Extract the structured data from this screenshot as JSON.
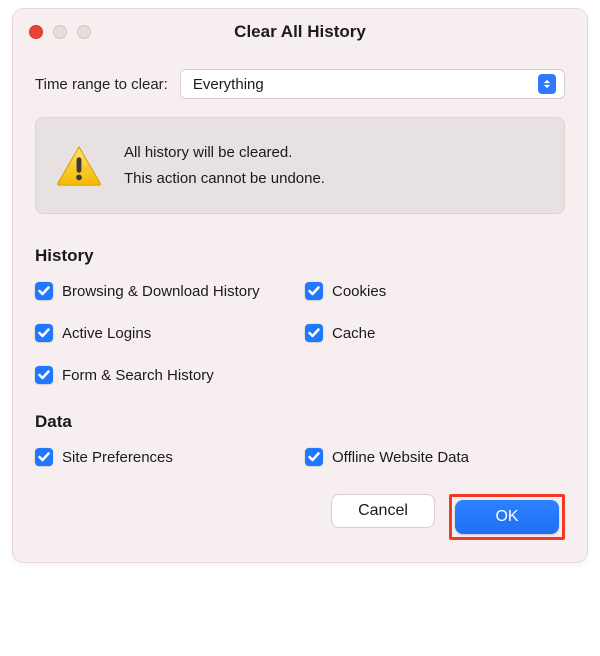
{
  "titlebar": {
    "title": "Clear All History"
  },
  "range": {
    "label": "Time range to clear:",
    "selected": "Everything"
  },
  "warning": {
    "line1": "All history will be cleared.",
    "line2": "This action cannot be undone."
  },
  "history": {
    "heading": "History",
    "items": {
      "browsing": "Browsing & Download History",
      "cookies": "Cookies",
      "active_logins": "Active Logins",
      "cache": "Cache",
      "form_search": "Form & Search History"
    }
  },
  "data": {
    "heading": "Data",
    "items": {
      "site_prefs": "Site Preferences",
      "offline": "Offline Website Data"
    }
  },
  "buttons": {
    "cancel": "Cancel",
    "ok": "OK"
  }
}
